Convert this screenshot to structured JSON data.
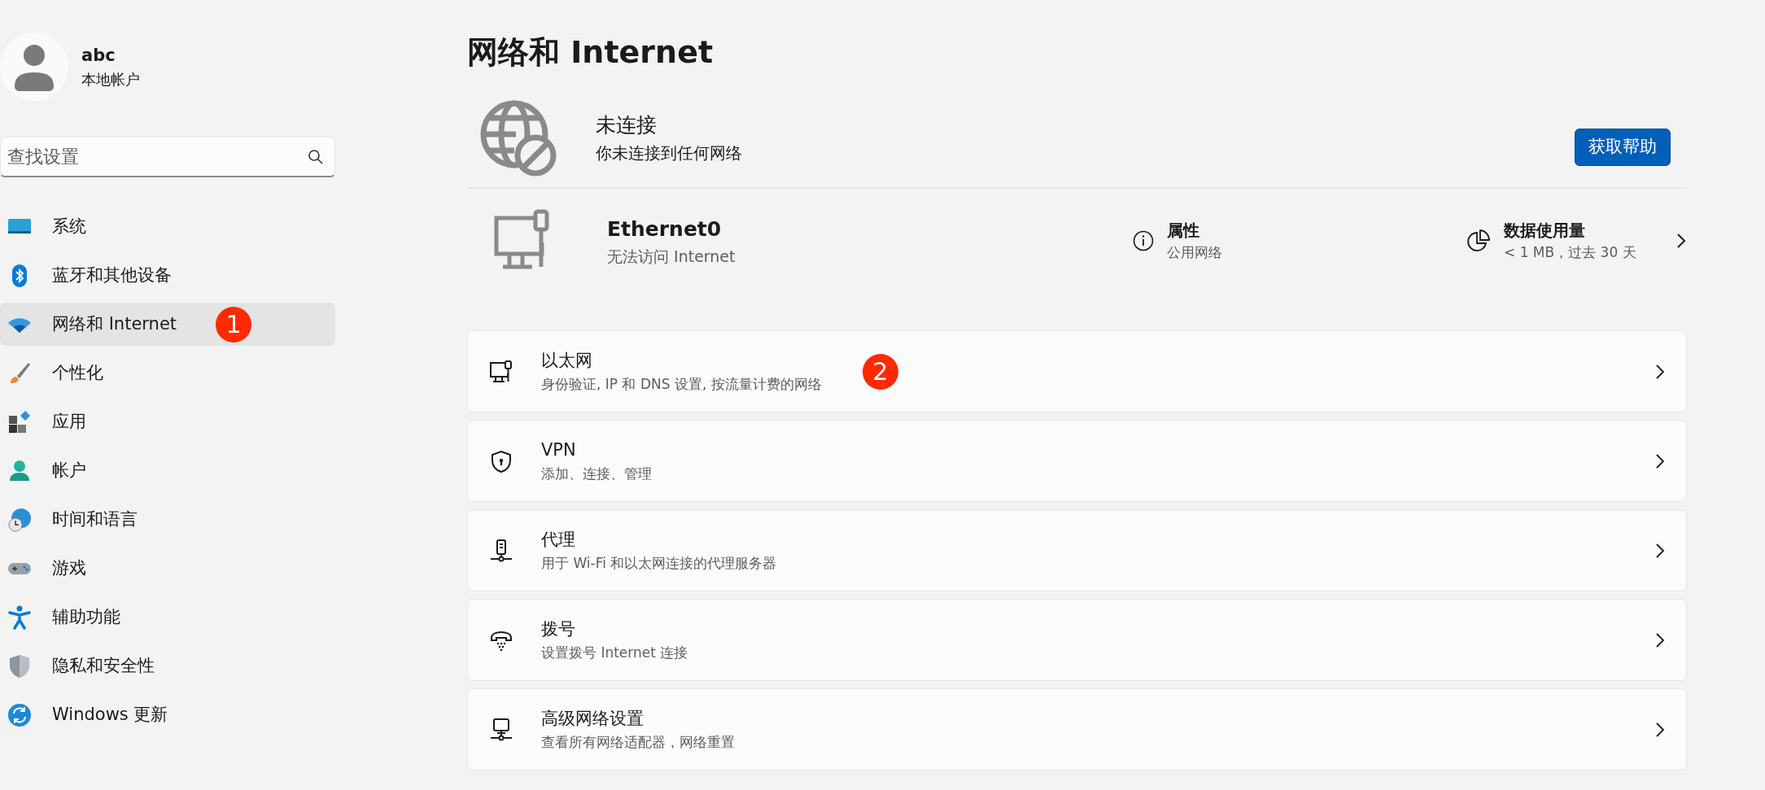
{
  "user": {
    "name": "abc",
    "account_type": "本地帐户"
  },
  "search": {
    "placeholder": "查找设置"
  },
  "sidebar": {
    "items": [
      {
        "label": "系统",
        "selected": false
      },
      {
        "label": "蓝牙和其他设备",
        "selected": false
      },
      {
        "label": "网络和 Internet",
        "selected": true,
        "badge": "1"
      },
      {
        "label": "个性化",
        "selected": false
      },
      {
        "label": "应用",
        "selected": false
      },
      {
        "label": "帐户",
        "selected": false
      },
      {
        "label": "时间和语言",
        "selected": false
      },
      {
        "label": "游戏",
        "selected": false
      },
      {
        "label": "辅助功能",
        "selected": false
      },
      {
        "label": "隐私和安全性",
        "selected": false
      },
      {
        "label": "Windows 更新",
        "selected": false
      }
    ]
  },
  "page_title": "网络和 Internet",
  "status": {
    "title": "未连接",
    "subtitle": "你未连接到任何网络",
    "help_button": "获取帮助"
  },
  "adapter": {
    "name": "Ethernet0",
    "status": "无法访问 Internet",
    "properties": {
      "title": "属性",
      "value": "公用网络"
    },
    "data_usage": {
      "title": "数据使用量",
      "value": "< 1 MB，过去 30 天"
    }
  },
  "settings": [
    {
      "title": "以太网",
      "description": "身份验证, IP 和 DNS 设置, 按流量计费的网络",
      "badge": "2"
    },
    {
      "title": "VPN",
      "description": "添加、连接、管理"
    },
    {
      "title": "代理",
      "description": "用于 Wi-Fi 和以太网连接的代理服务器"
    },
    {
      "title": "拨号",
      "description": "设置拨号 Internet 连接"
    },
    {
      "title": "高级网络设置",
      "description": "查看所有网络适配器，网络重置"
    }
  ]
}
